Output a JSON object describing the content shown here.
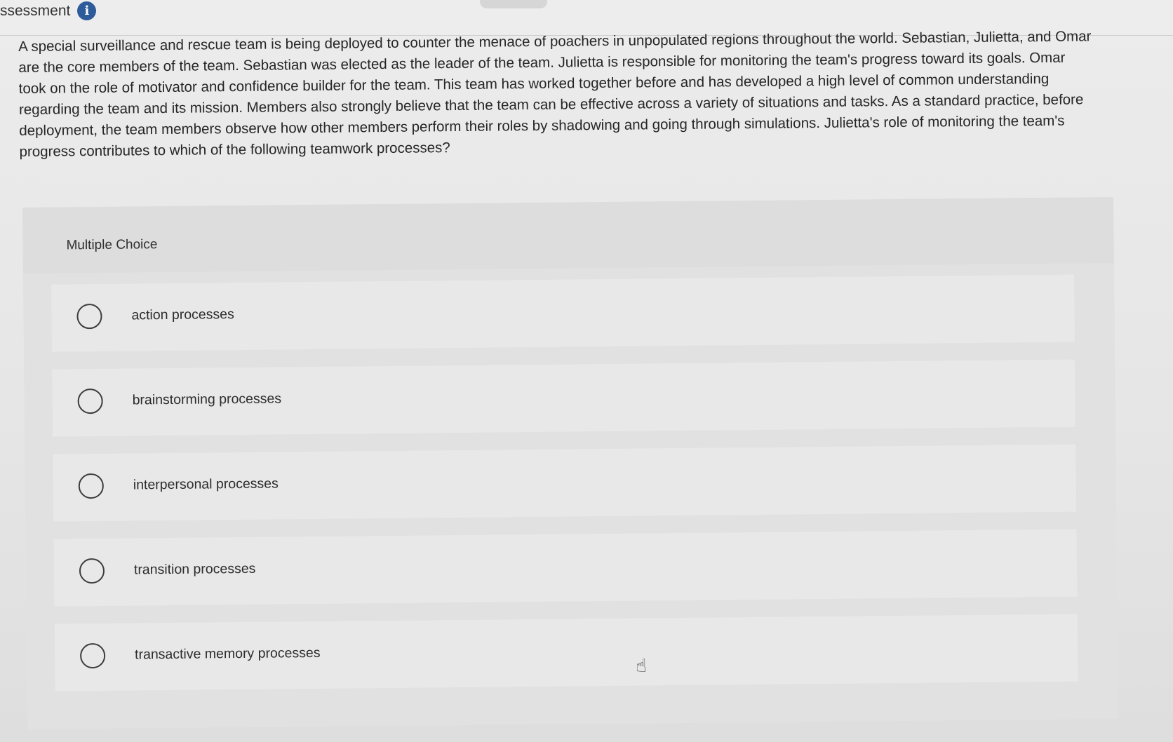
{
  "header": {
    "title": "ssessment",
    "info_icon": "info-icon"
  },
  "question": {
    "text": "A special surveillance and rescue team is being deployed to counter the menace of poachers in unpopulated regions throughout the world. Sebastian, Julietta, and Omar are the core members of the team. Sebastian was elected as the leader of the team. Julietta is responsible for monitoring the team's progress toward its goals. Omar took on the role of motivator and confidence builder for the team. This team has worked together before and has developed a high level of common understanding regarding the team and its mission. Members also strongly believe that the team can be effective across a variety of situations and tasks. As a standard practice, before deployment, the team members observe how other members perform their roles by shadowing and going through simulations. Julietta's role of monitoring the team's progress contributes to which of the following teamwork processes?"
  },
  "multiple_choice": {
    "label": "Multiple Choice",
    "options": [
      {
        "label": "action processes"
      },
      {
        "label": "brainstorming processes"
      },
      {
        "label": "interpersonal processes"
      },
      {
        "label": "transition processes"
      },
      {
        "label": "transactive memory processes"
      }
    ]
  },
  "cursor": {
    "icon": "hand-pointer-icon"
  }
}
